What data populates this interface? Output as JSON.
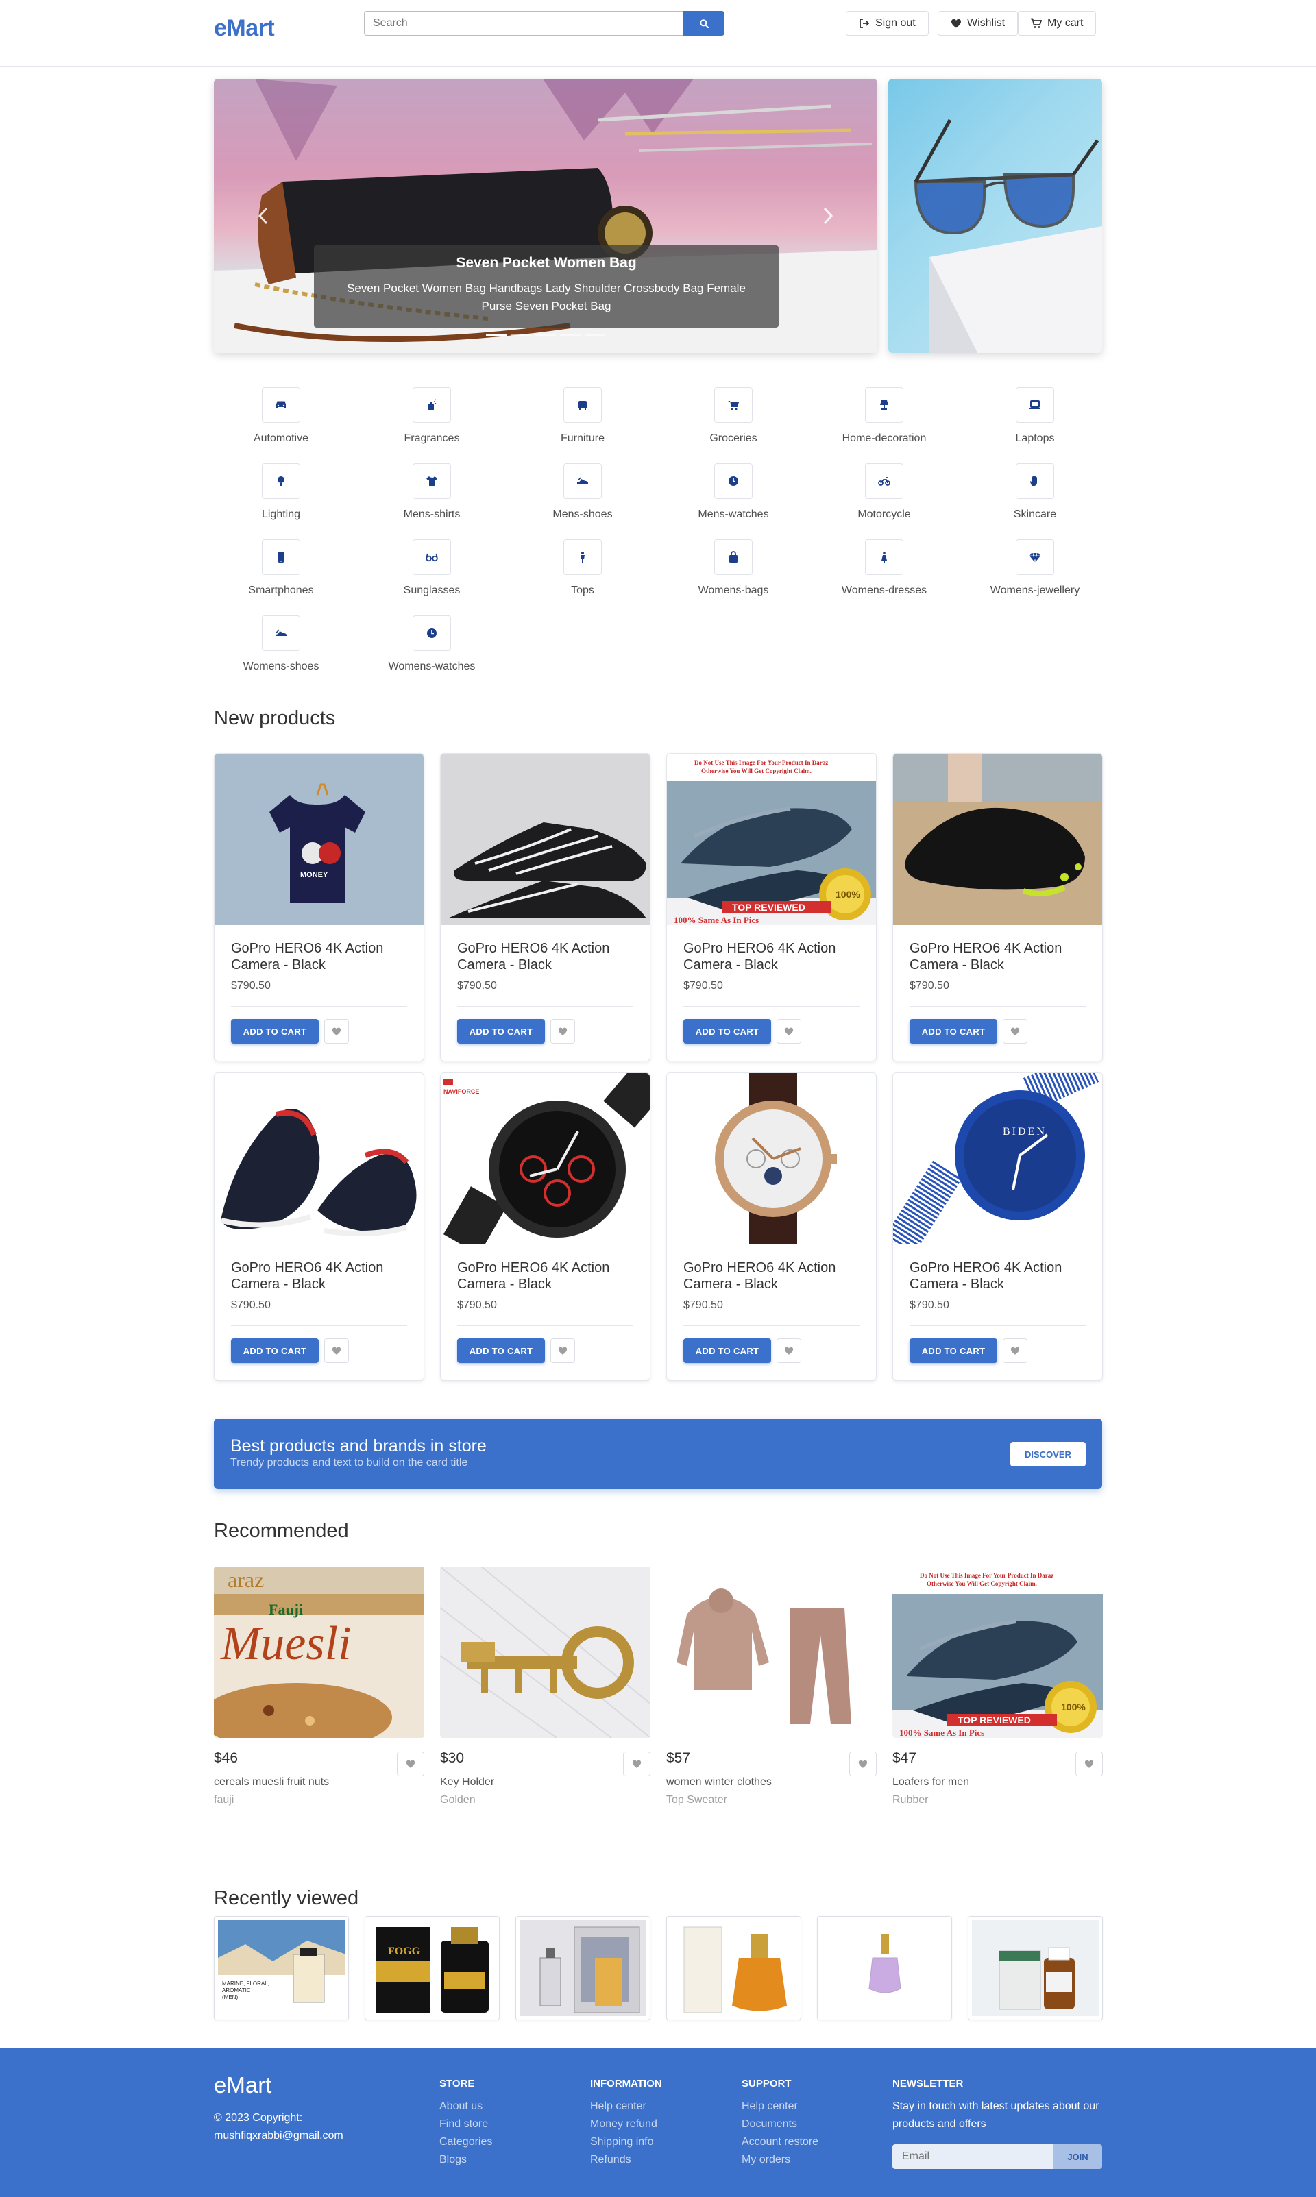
{
  "header": {
    "logo": "eMart",
    "search_placeholder": "Search",
    "signout_label": "Sign out",
    "wishlist_label": "Wishlist",
    "cart_label": "My cart"
  },
  "hero": {
    "caption_title": "Seven Pocket Women Bag",
    "caption_text": "Seven Pocket Women Bag Handbags Lady Shoulder Crossbody Bag Female Purse Seven Pocket Bag",
    "slide_count": 5,
    "active_slide": 1
  },
  "categories": [
    {
      "label": "Automotive",
      "icon": "car-icon"
    },
    {
      "label": "Fragrances",
      "icon": "spray-bottle-icon"
    },
    {
      "label": "Furniture",
      "icon": "couch-icon"
    },
    {
      "label": "Groceries",
      "icon": "basket-icon"
    },
    {
      "label": "Home-decoration",
      "icon": "lamp-icon"
    },
    {
      "label": "Laptops",
      "icon": "laptop-icon"
    },
    {
      "label": "Lighting",
      "icon": "lightbulb-icon"
    },
    {
      "label": "Mens-shirts",
      "icon": "tshirt-icon"
    },
    {
      "label": "Mens-shoes",
      "icon": "shoe-icon"
    },
    {
      "label": "Mens-watches",
      "icon": "clock-icon"
    },
    {
      "label": "Motorcycle",
      "icon": "motorcycle-icon"
    },
    {
      "label": "Skincare",
      "icon": "hand-icon"
    },
    {
      "label": "Smartphones",
      "icon": "phone-icon"
    },
    {
      "label": "Sunglasses",
      "icon": "glasses-icon"
    },
    {
      "label": "Tops",
      "icon": "person-icon"
    },
    {
      "label": "Womens-bags",
      "icon": "bag-icon"
    },
    {
      "label": "Womens-dresses",
      "icon": "dress-icon"
    },
    {
      "label": "Womens-jewellery",
      "icon": "gem-icon"
    },
    {
      "label": "Womens-shoes",
      "icon": "shoe-icon"
    },
    {
      "label": "Womens-watches",
      "icon": "clock-icon"
    }
  ],
  "new_products": {
    "title": "New products",
    "items": [
      {
        "title": "GoPro HERO6 4K Action Camera - Black",
        "price": "$790.50",
        "cart_label": "ADD TO CART",
        "image": "navy-tshirt"
      },
      {
        "title": "GoPro HERO6 4K Action Camera - Black",
        "price": "$790.50",
        "cart_label": "ADD TO CART",
        "image": "black-sneakers"
      },
      {
        "title": "GoPro HERO6 4K Action Camera - Black",
        "price": "$790.50",
        "cart_label": "ADD TO CART",
        "image": "loafers"
      },
      {
        "title": "GoPro HERO6 4K Action Camera - Black",
        "price": "$790.50",
        "cart_label": "ADD TO CART",
        "image": "water-shoe"
      },
      {
        "title": "GoPro HERO6 4K Action Camera - Black",
        "price": "$790.50",
        "cart_label": "ADD TO CART",
        "image": "slip-on-shoes"
      },
      {
        "title": "GoPro HERO6 4K Action Camera - Black",
        "price": "$790.50",
        "cart_label": "ADD TO CART",
        "image": "black-red-watch"
      },
      {
        "title": "GoPro HERO6 4K Action Camera - Black",
        "price": "$790.50",
        "cart_label": "ADD TO CART",
        "image": "gold-watch"
      },
      {
        "title": "GoPro HERO6 4K Action Camera - Black",
        "price": "$790.50",
        "cart_label": "ADD TO CART",
        "image": "blue-watch"
      }
    ]
  },
  "promo": {
    "title": "Best products and brands in store",
    "subtitle": "Trendy products and text to build on the card title",
    "button_label": "DISCOVER"
  },
  "recommended": {
    "title": "Recommended",
    "items": [
      {
        "price": "$46",
        "name": "cereals muesli fruit nuts",
        "brand": "fauji",
        "image": "muesli"
      },
      {
        "price": "$30",
        "name": "Key Holder",
        "brand": "Golden",
        "image": "key-holder"
      },
      {
        "price": "$57",
        "name": "women winter clothes",
        "brand": "Top Sweater",
        "image": "sweater"
      },
      {
        "price": "$47",
        "name": "Loafers for men",
        "brand": "Rubber",
        "image": "loafers"
      }
    ]
  },
  "recently_viewed": {
    "title": "Recently viewed",
    "items": [
      "perfume-marine",
      "fogg-perfume",
      "perfume-box",
      "orange-perfume",
      "small-perfume",
      "oil-bottle"
    ]
  },
  "footer": {
    "logo": "eMart",
    "copyright": "© 2023 Copyright: mushfiqxrabbi@gmail.com",
    "store": {
      "title": "STORE",
      "links": [
        "About us",
        "Find store",
        "Categories",
        "Blogs"
      ]
    },
    "information": {
      "title": "INFORMATION",
      "links": [
        "Help center",
        "Money refund",
        "Shipping info",
        "Refunds"
      ]
    },
    "support": {
      "title": "SUPPORT",
      "links": [
        "Help center",
        "Documents",
        "Account restore",
        "My orders"
      ]
    },
    "newsletter": {
      "title": "NEWSLETTER",
      "text": "Stay in touch with latest updates about our products and offers",
      "email_placeholder": "Email",
      "join_label": "JOIN"
    }
  },
  "colors": {
    "primary": "#3b71ca",
    "icon": "#1c3f8c"
  }
}
